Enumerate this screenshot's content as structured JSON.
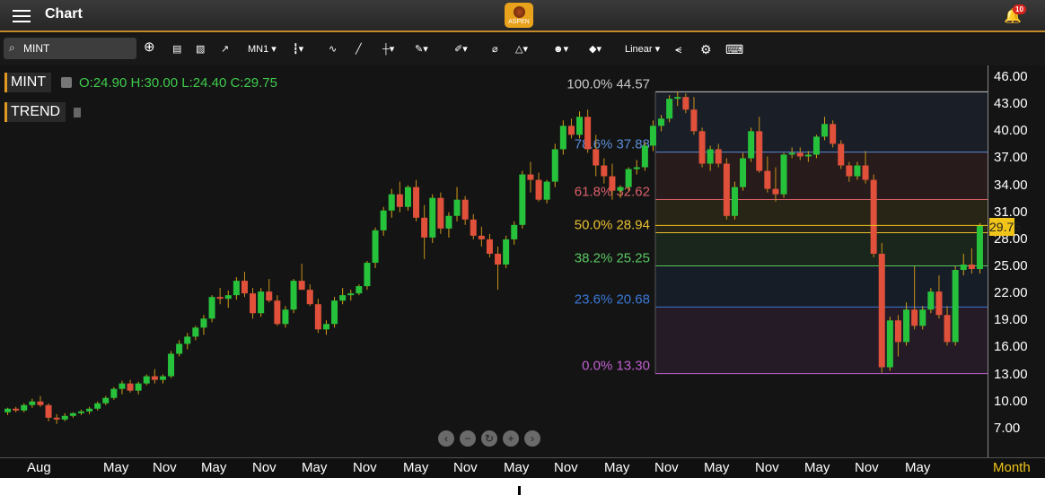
{
  "titlebar": {
    "title": "Chart",
    "logo_text": "ASPEN",
    "notification_count": "10"
  },
  "toolbar": {
    "symbol": "MINT",
    "period": "MN1 ▾",
    "scale": "Linear ▾",
    "icons": [
      "add-icon",
      "new-doc-icon",
      "template-icon",
      "compare-icon",
      "chart-type-icon",
      "indicator-icon",
      "line-icon",
      "crosshair-icon",
      "pencil-icon",
      "signature-icon",
      "ruler-icon",
      "shapes-icon",
      "emoji-icon",
      "tag-icon",
      "share-icon",
      "settings-icon",
      "keyboard-icon"
    ]
  },
  "legend": {
    "symbol": "MINT",
    "ohlc": "O:24.90 H:30.00 L:24.40 C:29.75",
    "study": "TREND"
  },
  "colors": {
    "up": "#27c23c",
    "down": "#e0503a",
    "accent": "#f0c419",
    "brand": "#e9a21c"
  },
  "chart_data": {
    "type": "candlestick",
    "yaxis_ticks": [
      "46.00",
      "43.00",
      "40.00",
      "37.00",
      "34.00",
      "31.00",
      "28.00",
      "25.00",
      "22.00",
      "19.00",
      "16.00",
      "13.00",
      "10.00",
      "7.00"
    ],
    "xaxis_ticks": [
      "Aug",
      "May",
      "Nov",
      "May",
      "Nov",
      "May",
      "Nov",
      "May",
      "Nov",
      "May",
      "Nov",
      "May",
      "Nov",
      "May",
      "Nov",
      "May",
      "Nov",
      "May"
    ],
    "xaxis_unit": "Month",
    "ylim": [
      4,
      47.5
    ],
    "last_price": "29.75",
    "fibonacci": [
      {
        "level": "100.0%",
        "price": "44.57",
        "color": "#c8c8c8"
      },
      {
        "level": "78.6%",
        "price": "37.88",
        "color": "#5a8cd8"
      },
      {
        "level": "61.8%",
        "price": "32.62",
        "color": "#d8606a"
      },
      {
        "level": "50.0%",
        "price": "28.94",
        "color": "#e8c030"
      },
      {
        "level": "38.2%",
        "price": "25.25",
        "color": "#58c860"
      },
      {
        "level": "23.6%",
        "price": "20.68",
        "color": "#3a78d8"
      },
      {
        "level": "0.0%",
        "price": "13.30",
        "color": "#c060d0"
      }
    ],
    "candles": [
      [
        9.0,
        9.5,
        8.7,
        9.4
      ],
      [
        9.4,
        9.6,
        9.0,
        9.2
      ],
      [
        9.2,
        10.0,
        9.0,
        9.8
      ],
      [
        9.8,
        10.5,
        9.5,
        10.2
      ],
      [
        10.2,
        10.8,
        9.6,
        9.8
      ],
      [
        9.8,
        10.0,
        8.0,
        8.4
      ],
      [
        8.4,
        8.8,
        7.7,
        8.2
      ],
      [
        8.2,
        8.9,
        8.0,
        8.6
      ],
      [
        8.6,
        9.0,
        8.4,
        8.9
      ],
      [
        8.9,
        9.3,
        8.7,
        9.1
      ],
      [
        9.1,
        9.6,
        8.8,
        9.4
      ],
      [
        9.4,
        10.2,
        9.2,
        10.0
      ],
      [
        10.0,
        10.8,
        9.8,
        10.6
      ],
      [
        10.6,
        11.8,
        10.4,
        11.6
      ],
      [
        11.6,
        12.5,
        11.0,
        12.2
      ],
      [
        12.2,
        12.6,
        11.2,
        11.4
      ],
      [
        11.4,
        12.4,
        11.0,
        12.2
      ],
      [
        12.2,
        13.2,
        12.0,
        13.0
      ],
      [
        13.0,
        13.8,
        12.2,
        12.6
      ],
      [
        12.6,
        13.2,
        12.2,
        13.0
      ],
      [
        13.0,
        15.8,
        12.8,
        15.5
      ],
      [
        15.5,
        17.0,
        15.2,
        16.6
      ],
      [
        16.6,
        17.8,
        16.0,
        17.4
      ],
      [
        17.4,
        18.6,
        17.0,
        18.4
      ],
      [
        18.4,
        19.8,
        17.6,
        19.4
      ],
      [
        19.4,
        22.0,
        19.0,
        21.8
      ],
      [
        21.8,
        22.8,
        21.0,
        21.6
      ],
      [
        21.6,
        22.5,
        20.6,
        22.0
      ],
      [
        22.0,
        24.0,
        21.5,
        23.6
      ],
      [
        23.6,
        24.6,
        21.8,
        22.2
      ],
      [
        22.2,
        22.8,
        19.4,
        20.0
      ],
      [
        20.0,
        22.8,
        19.6,
        22.4
      ],
      [
        22.4,
        23.8,
        21.2,
        21.4
      ],
      [
        21.4,
        22.0,
        18.6,
        18.8
      ],
      [
        18.8,
        20.8,
        18.4,
        20.4
      ],
      [
        20.4,
        23.8,
        20.0,
        23.6
      ],
      [
        23.6,
        25.5,
        23.0,
        22.6
      ],
      [
        22.6,
        23.2,
        20.8,
        21.0
      ],
      [
        21.0,
        21.6,
        17.8,
        18.2
      ],
      [
        18.2,
        19.2,
        17.6,
        18.8
      ],
      [
        18.8,
        21.8,
        18.4,
        21.4
      ],
      [
        21.4,
        22.8,
        21.0,
        22.0
      ],
      [
        22.0,
        22.6,
        21.4,
        22.2
      ],
      [
        22.2,
        23.2,
        22.0,
        23.0
      ],
      [
        23.0,
        25.8,
        22.6,
        25.6
      ],
      [
        25.6,
        29.5,
        25.0,
        29.2
      ],
      [
        29.2,
        31.8,
        28.6,
        31.4
      ],
      [
        31.4,
        33.8,
        30.6,
        33.2
      ],
      [
        33.2,
        34.6,
        31.2,
        31.8
      ],
      [
        31.8,
        34.2,
        31.4,
        34.0
      ],
      [
        34.0,
        34.8,
        30.2,
        30.6
      ],
      [
        30.6,
        32.0,
        26.0,
        28.4
      ],
      [
        28.4,
        33.2,
        27.8,
        32.8
      ],
      [
        32.8,
        33.4,
        28.8,
        29.4
      ],
      [
        29.4,
        31.2,
        28.4,
        30.8
      ],
      [
        30.8,
        34.0,
        30.2,
        32.6
      ],
      [
        32.6,
        33.0,
        29.8,
        30.4
      ],
      [
        30.4,
        31.0,
        28.2,
        28.6
      ],
      [
        28.6,
        29.6,
        27.4,
        28.2
      ],
      [
        28.2,
        28.8,
        26.2,
        26.6
      ],
      [
        26.6,
        27.4,
        22.6,
        25.4
      ],
      [
        25.4,
        28.6,
        25.0,
        28.2
      ],
      [
        28.2,
        30.2,
        27.6,
        29.8
      ],
      [
        29.8,
        35.8,
        29.4,
        35.4
      ],
      [
        35.4,
        36.8,
        33.4,
        34.8
      ],
      [
        34.8,
        35.6,
        32.4,
        32.6
      ],
      [
        32.6,
        34.8,
        32.2,
        34.6
      ],
      [
        34.6,
        38.8,
        34.0,
        38.2
      ],
      [
        38.2,
        41.4,
        37.6,
        40.8
      ],
      [
        40.8,
        41.6,
        39.4,
        39.8
      ],
      [
        39.8,
        42.4,
        39.4,
        41.8
      ],
      [
        41.8,
        42.6,
        37.8,
        38.2
      ],
      [
        38.2,
        39.8,
        35.2,
        36.4
      ],
      [
        36.4,
        37.2,
        34.4,
        35.2
      ],
      [
        35.2,
        36.6,
        32.6,
        33.6
      ],
      [
        33.6,
        34.2,
        32.8,
        34.0
      ],
      [
        34.0,
        36.2,
        33.6,
        36.0
      ],
      [
        36.0,
        37.0,
        35.4,
        36.2
      ],
      [
        36.2,
        39.0,
        35.8,
        38.6
      ],
      [
        38.6,
        41.4,
        38.0,
        40.8
      ],
      [
        40.8,
        42.0,
        40.2,
        41.6
      ],
      [
        41.6,
        44.2,
        41.2,
        43.8
      ],
      [
        43.8,
        44.6,
        43.0,
        44.0
      ],
      [
        44.0,
        44.4,
        42.2,
        42.6
      ],
      [
        42.6,
        44.0,
        39.8,
        40.2
      ],
      [
        40.2,
        40.6,
        36.2,
        36.6
      ],
      [
        36.6,
        38.6,
        35.8,
        38.2
      ],
      [
        38.2,
        38.8,
        36.2,
        36.6
      ],
      [
        36.6,
        37.2,
        30.4,
        30.8
      ],
      [
        30.8,
        34.6,
        30.4,
        34.0
      ],
      [
        34.0,
        37.8,
        33.6,
        37.2
      ],
      [
        37.2,
        40.6,
        36.8,
        40.2
      ],
      [
        40.2,
        41.8,
        35.6,
        35.8
      ],
      [
        35.8,
        37.4,
        33.4,
        33.8
      ],
      [
        33.8,
        36.2,
        32.4,
        33.2
      ],
      [
        33.2,
        37.8,
        32.8,
        37.6
      ],
      [
        37.6,
        38.4,
        37.2,
        37.8
      ],
      [
        37.8,
        38.4,
        37.0,
        37.4
      ],
      [
        37.4,
        38.0,
        36.8,
        37.6
      ],
      [
        37.6,
        39.8,
        37.2,
        39.6
      ],
      [
        39.6,
        41.8,
        39.2,
        41.0
      ],
      [
        41.0,
        41.4,
        38.4,
        38.8
      ],
      [
        38.8,
        39.2,
        36.0,
        36.4
      ],
      [
        36.4,
        36.8,
        34.6,
        35.2
      ],
      [
        35.2,
        36.8,
        34.8,
        36.4
      ],
      [
        36.4,
        38.0,
        34.4,
        34.8
      ],
      [
        34.8,
        35.4,
        26.2,
        26.6
      ],
      [
        26.6,
        27.8,
        13.4,
        14.0
      ],
      [
        14.0,
        19.6,
        13.6,
        19.2
      ],
      [
        19.2,
        19.8,
        15.2,
        16.8
      ],
      [
        16.8,
        21.2,
        16.4,
        20.4
      ],
      [
        20.4,
        25.2,
        18.2,
        18.6
      ],
      [
        18.6,
        20.8,
        18.2,
        20.4
      ],
      [
        20.4,
        22.8,
        20.0,
        22.4
      ],
      [
        22.4,
        24.2,
        19.4,
        19.8
      ],
      [
        19.8,
        20.8,
        16.4,
        16.8
      ],
      [
        16.8,
        25.2,
        16.4,
        24.8
      ],
      [
        24.8,
        26.6,
        24.2,
        25.4
      ],
      [
        25.4,
        27.2,
        24.4,
        24.9
      ],
      [
        24.9,
        30.0,
        24.4,
        29.75
      ]
    ]
  }
}
